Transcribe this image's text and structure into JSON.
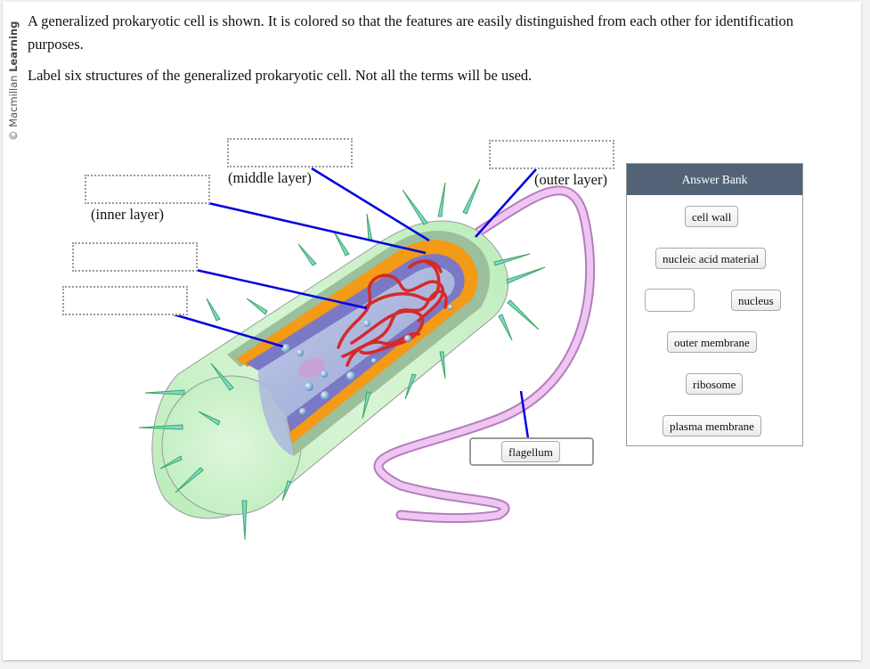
{
  "credit": {
    "prefix": "© Macmillan ",
    "bold": "Learning"
  },
  "question": {
    "intro": "A generalized prokaryotic cell is shown. It is colored so that the features are easily distinguished from each other for identification purposes.",
    "instruction": "Label six structures of the generalized prokaryotic cell. Not all the terms will be used."
  },
  "diagram": {
    "hints": {
      "middle": "(middle layer)",
      "inner": "(inner layer)",
      "outer": "(outer layer)"
    },
    "targets": [
      {
        "id": "middle-layer",
        "value": ""
      },
      {
        "id": "inner-layer",
        "value": ""
      },
      {
        "id": "nucleic-acid",
        "value": ""
      },
      {
        "id": "ribosome",
        "value": ""
      },
      {
        "id": "outer-layer",
        "value": ""
      },
      {
        "id": "flagellum",
        "value": "flagellum"
      }
    ],
    "colors": {
      "leader": "#0000e0",
      "capsule": "#c9f0c9",
      "wall": "#9cbf9c",
      "orange": "#f39a16",
      "membrane": "#7b78c6",
      "cytoplasm": "#a9b4dc",
      "dna": "#d42a2a",
      "flagellum": "#e5b5ea",
      "pili": "#7fd6d6"
    }
  },
  "answer_bank": {
    "title": "Answer Bank",
    "items": [
      "cell wall",
      "nucleic acid material",
      "nucleus",
      "outer membrane",
      "ribosome",
      "plasma membrane"
    ]
  }
}
